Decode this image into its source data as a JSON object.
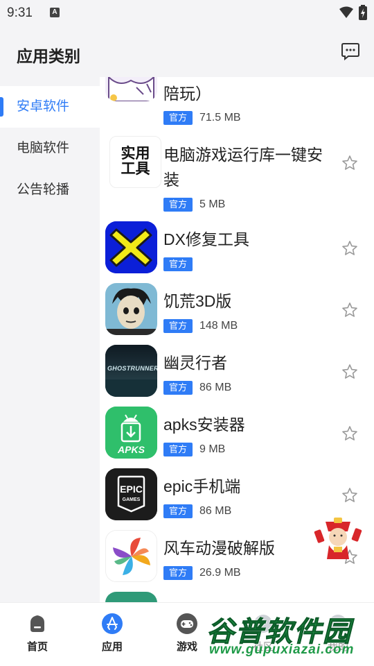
{
  "status_bar": {
    "time": "9:31",
    "notification_icon": "a-notification-icon",
    "wifi_icon": "wifi-icon",
    "battery_icon": "battery-charging-icon"
  },
  "header": {
    "title": "应用类别",
    "message_icon": "message-icon"
  },
  "sidebar": {
    "items": [
      {
        "label": "安卓软件",
        "active": true
      },
      {
        "label": "电脑软件",
        "active": false
      },
      {
        "label": "公告轮播",
        "active": false
      }
    ]
  },
  "apps": [
    {
      "name": "陪玩）",
      "badge": "官方",
      "size": "71.5 MB"
    },
    {
      "name": "电脑游戏运行库一键安装",
      "badge": "官方",
      "size": "5 MB",
      "icon_text": [
        "实用",
        "工具"
      ]
    },
    {
      "name": "DX修复工具",
      "badge": "官方",
      "size": ""
    },
    {
      "name": "饥荒3D版",
      "badge": "官方",
      "size": "148 MB"
    },
    {
      "name": "幽灵行者",
      "badge": "官方",
      "size": "86 MB",
      "icon_text": "GHOSTRUNNER"
    },
    {
      "name": "apks安装器",
      "badge": "官方",
      "size": "9 MB",
      "icon_text": "APKS"
    },
    {
      "name": "epic手机端",
      "badge": "官方",
      "size": "86 MB",
      "icon_text": [
        "EPIC",
        "GAMES"
      ]
    },
    {
      "name": "风车动漫破解版",
      "badge": "官方",
      "size": "26.9 MB"
    }
  ],
  "bottom_nav": [
    {
      "label": "首页",
      "icon": "home-icon"
    },
    {
      "label": "应用",
      "icon": "app-store-icon"
    },
    {
      "label": "游戏",
      "icon": "gamepad-icon"
    },
    {
      "label": "社区",
      "icon": "community-icon"
    },
    {
      "label": "我的",
      "icon": "profile-icon"
    }
  ],
  "watermark": {
    "title": "谷普软件园",
    "url": "www.gupuxiazai.com"
  },
  "colors": {
    "accent": "#2f7cf6",
    "background": "#f4f4f6",
    "watermark_green": "#1f9a48"
  }
}
